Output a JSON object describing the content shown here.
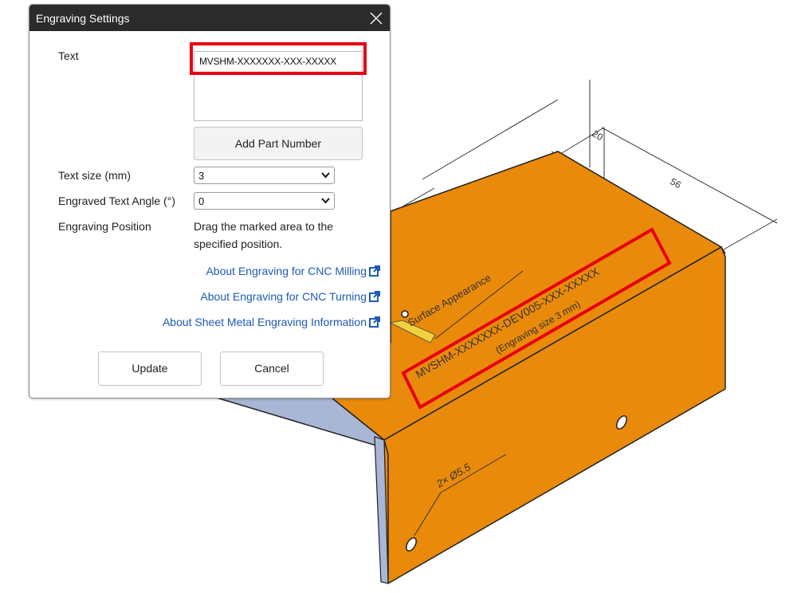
{
  "dialog": {
    "title": "Engraving Settings",
    "text_label": "Text",
    "text_value": "MVSHM-XXXXXXX-XXX-XXXXX",
    "add_part_number_label": "Add Part Number",
    "text_size_label": "Text size (mm)",
    "text_size_value": "3",
    "angle_label": "Engraved Text Angle (°)",
    "angle_value": "0",
    "position_label": "Engraving Position",
    "position_desc_line1": "Drag the marked area to the",
    "position_desc_line2": "specified position.",
    "links": [
      "About Engraving for CNC Milling",
      "About Engraving for CNC Turning",
      "About Sheet Metal Engraving Information"
    ],
    "update_label": "Update",
    "cancel_label": "Cancel"
  },
  "drawing": {
    "surface_label": "Surface Appearance",
    "engraving_text": "MVSHM-XXXXXXX-DEV005-XXX-XXXXX",
    "engraving_size_note": "(Engraving size 3 mm)",
    "hole_callout": "2× Ø5.5",
    "dim_56": "56",
    "dim_20": "20"
  },
  "colors": {
    "part_fill": "#e98a0b",
    "highlight": "#e60012",
    "link": "#1d5ab5",
    "title_bar": "#2b2b2b"
  }
}
